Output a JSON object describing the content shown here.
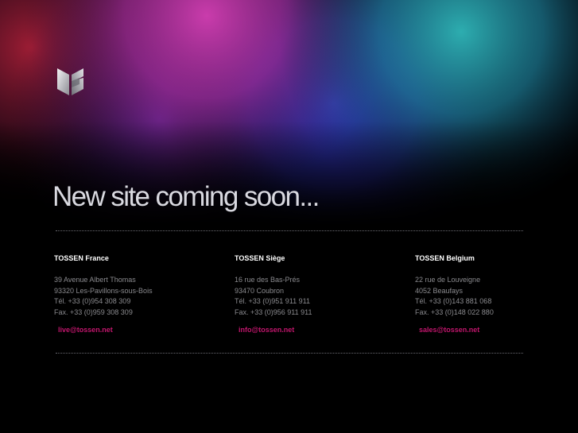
{
  "headline": "New site coming soon...",
  "logo": {
    "icon": "tossen-logo-icon"
  },
  "offices": [
    {
      "name": "TOSSEN France",
      "address1": "39 Avenue Albert Thomas",
      "address2": "93320 Les-Pavillons-sous-Bois",
      "tel": "Tél. +33 (0)954 308 309",
      "fax": "Fax. +33 (0)959 308 309",
      "email": "live@tossen.net"
    },
    {
      "name": "TOSSEN Siège",
      "address1": "16 rue des Bas-Prés",
      "address2": "93470 Coubron",
      "tel": "Tél. +33 (0)951 911 911",
      "fax": "Fax. +33 (0)956 911 911",
      "email": "info@tossen.net"
    },
    {
      "name": "TOSSEN Belgium",
      "address1": "22 rue de Louveigne",
      "address2": "4052 Beaufays",
      "tel": "Tél. +33 (0)143 881 068",
      "fax": "Fax. +33 (0)148 022 880",
      "email": "sales@tossen.net"
    }
  ],
  "colors": {
    "background": "#000000",
    "headline": "#d9d9e0",
    "email": "#c0166c",
    "office_name": "#ffffff",
    "body_text": "#8a8a8e"
  }
}
